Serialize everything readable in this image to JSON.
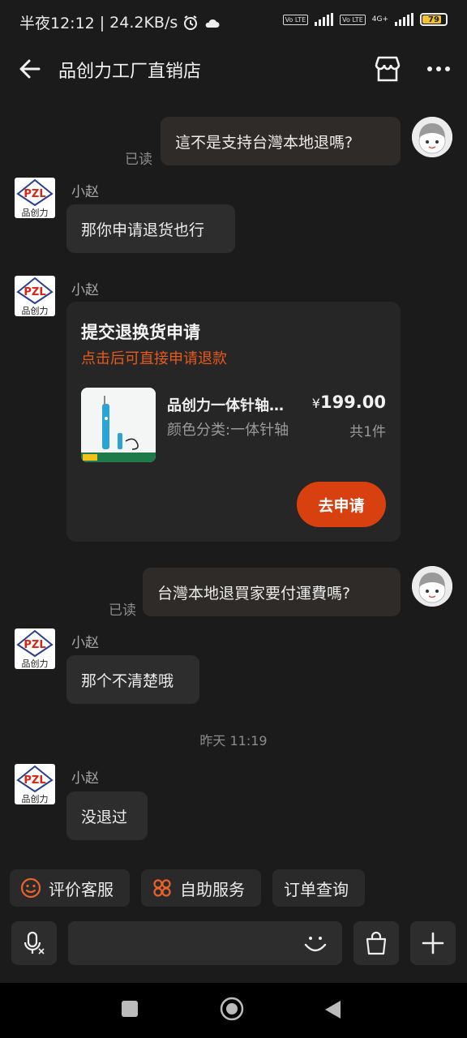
{
  "status_bar": {
    "time": "半夜12:12",
    "speed": "24.2KB/s",
    "net1_label": "Vo LTE",
    "net2_label": "Vo LTE",
    "net2_gen": "4G+",
    "battery": "79",
    "battery_color": "#f2c230"
  },
  "header": {
    "title": "品创力工厂直销店",
    "back_icon": "arrow-left-icon",
    "store_icon": "store-icon",
    "more_icon": "more-dots-icon"
  },
  "shop_logo": {
    "brand": "PZL",
    "name": "品创力"
  },
  "messages": {
    "m1": {
      "text": "這不是支持台灣本地退嗎?",
      "read": "已读"
    },
    "m2": {
      "sender": "小赵",
      "text": "那你申请退货也行"
    },
    "m3": {
      "sender": "小赵",
      "card_title": "提交退换货申请",
      "card_subtitle": "点击后可直接申请退款",
      "product_name": "品创力一体针轴气动气囊",
      "product_spec": "颜色分类:一体针轴",
      "currency": "¥",
      "price": "199.00",
      "quantity": "共1件",
      "button": "去申请",
      "accent": "#d9400f"
    },
    "m4": {
      "text": "台灣本地退買家要付運費嗎?",
      "read": "已读"
    },
    "m5": {
      "sender": "小赵",
      "text": "那个不清楚哦"
    },
    "time_sep": "昨天  11:19",
    "m6": {
      "sender": "小赵",
      "text": "没退过"
    }
  },
  "quick_actions": [
    {
      "label": "评价客服",
      "icon": "smile-icon"
    },
    {
      "label": "自助服务",
      "icon": "flower-grid-icon"
    },
    {
      "label": "订单查询",
      "icon": ""
    }
  ],
  "input_bar": {
    "voice_icon": "mic-icon",
    "emoji_icon": "emoji-icon",
    "shop_icon": "shopping-bag-icon",
    "plus_icon": "plus-icon",
    "placeholder": ""
  }
}
